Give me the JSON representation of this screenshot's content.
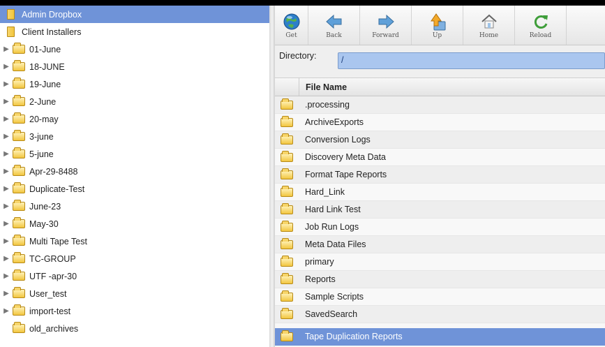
{
  "tree": {
    "items": [
      {
        "label": "Admin Dropbox",
        "icon": "dropbox-icon",
        "expandable": false,
        "selected": true
      },
      {
        "label": "Client Installers",
        "icon": "dropbox-icon",
        "expandable": false,
        "selected": false
      },
      {
        "label": "01-June",
        "icon": "folder-icon",
        "expandable": true
      },
      {
        "label": "18-JUNE",
        "icon": "folder-icon",
        "expandable": true
      },
      {
        "label": "19-June",
        "icon": "folder-icon",
        "expandable": true
      },
      {
        "label": "2-June",
        "icon": "folder-icon",
        "expandable": true
      },
      {
        "label": "20-may",
        "icon": "folder-icon",
        "expandable": true
      },
      {
        "label": "3-june",
        "icon": "folder-icon",
        "expandable": true
      },
      {
        "label": "5-june",
        "icon": "folder-icon",
        "expandable": true
      },
      {
        "label": "Apr-29-8488",
        "icon": "folder-icon",
        "expandable": true
      },
      {
        "label": "Duplicate-Test",
        "icon": "folder-icon",
        "expandable": true
      },
      {
        "label": "June-23",
        "icon": "folder-icon",
        "expandable": true
      },
      {
        "label": "May-30",
        "icon": "folder-icon",
        "expandable": true
      },
      {
        "label": "Multi Tape Test",
        "icon": "folder-icon",
        "expandable": true
      },
      {
        "label": "TC-GROUP",
        "icon": "folder-icon",
        "expandable": true
      },
      {
        "label": "UTF -apr-30",
        "icon": "folder-icon",
        "expandable": true
      },
      {
        "label": "User_test",
        "icon": "folder-icon",
        "expandable": true
      },
      {
        "label": "import-test",
        "icon": "folder-icon",
        "expandable": true
      },
      {
        "label": "old_archives",
        "icon": "folder-icon",
        "expandable": false
      }
    ]
  },
  "toolbar": {
    "get_label": "Get",
    "back_label": "Back",
    "forward_label": "Forward",
    "up_label": "Up",
    "home_label": "Home",
    "reload_label": "Reload"
  },
  "directory": {
    "label": "Directory:",
    "value": "/"
  },
  "file_list": {
    "header": "File Name",
    "rows": [
      ".processing",
      "ArchiveExports",
      "Conversion Logs",
      "Discovery Meta Data",
      "Format Tape Reports",
      "Hard_Link",
      "Hard Link Test",
      "Job Run Logs",
      "Meta Data Files",
      "primary",
      "Reports",
      "Sample Scripts",
      "SavedSearch",
      "Tape Duplication Reports"
    ],
    "selected": "Tape Duplication Reports"
  },
  "colors": {
    "selection": "#6f93d8",
    "directory_input": "#aac6ef",
    "folder": "#f2c63f"
  }
}
